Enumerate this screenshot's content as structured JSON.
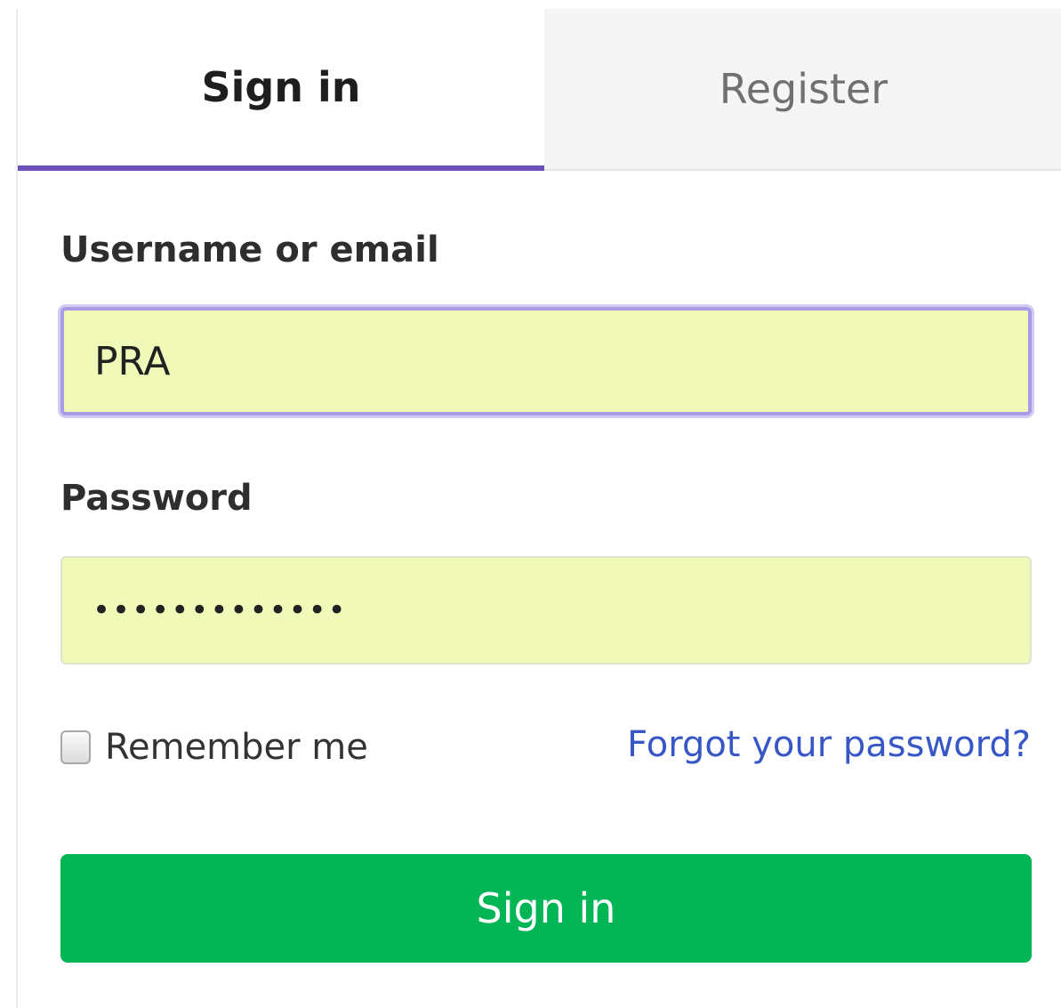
{
  "tabs": {
    "signin_label": "Sign in",
    "register_label": "Register"
  },
  "form": {
    "username_label": "Username or email",
    "username_value": "PRA",
    "password_label": "Password",
    "password_value": "•••••••••••••",
    "remember_label": "Remember me",
    "forgot_label": "Forgot your password?",
    "submit_label": "Sign in"
  },
  "colors": {
    "tab_active_border": "#6b4fbb",
    "input_autofill_bg": "#f1f9b9",
    "link": "#3857c7",
    "primary_button": "#02b656"
  }
}
